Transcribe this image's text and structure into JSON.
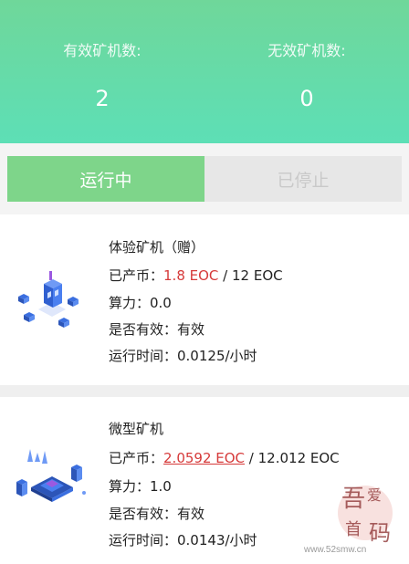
{
  "stats": {
    "valid_label": "有效矿机数:",
    "valid_value": "2",
    "invalid_label": "无效矿机数:",
    "invalid_value": "0"
  },
  "tabs": {
    "running": "运行中",
    "stopped": "已停止"
  },
  "miners": [
    {
      "name": "体验矿机（赠）",
      "produced_label": "已产币：",
      "produced": "1.8 EOC",
      "total": " / 12 EOC",
      "power": "算力：0.0",
      "valid": "是否有效：有效",
      "runtime": "运行时间：0.0125/小时",
      "icon": "server-cube-icon"
    },
    {
      "name": "微型矿机",
      "produced_label": "已产币：",
      "produced": "2.0592 EOC",
      "total": " / 12.012 EOC",
      "power": "算力：1.0",
      "valid": "是否有效：有效",
      "runtime": "运行时间：0.0143/小时",
      "icon": "chip-platform-icon"
    }
  ],
  "watermark": {
    "logo": "吾爱首码",
    "url": "www.52smw.cn"
  },
  "colors": {
    "header_top": "#6fd79a",
    "header_bottom": "#5ddfb6",
    "tab_active": "#7ed58a",
    "tab_inactive": "#e7e7e7",
    "produced_red": "#d63a3a",
    "illustration_blue": "#3b6fe0"
  }
}
